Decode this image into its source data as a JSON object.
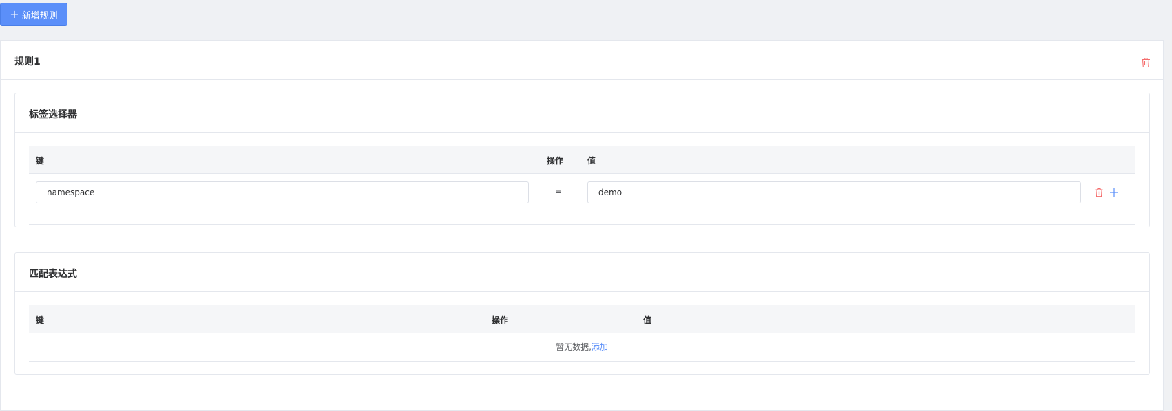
{
  "toolbar": {
    "add_rule_icon": "+",
    "add_rule_label": "新增规则"
  },
  "rule": {
    "title": "规则1",
    "delete_icon": "trash-icon",
    "label_selector": {
      "title": "标签选择器",
      "columns": {
        "key": "键",
        "operator": "操作",
        "value": "值"
      },
      "rows": [
        {
          "key": "namespace",
          "operator": "=",
          "value": "demo"
        }
      ]
    },
    "match_expressions": {
      "title": "匹配表达式",
      "columns": {
        "key": "键",
        "operator": "操作",
        "value": "值"
      },
      "empty_text": "暂无数据,",
      "add_link": "添加"
    }
  },
  "colors": {
    "primary": "#5b8ff9",
    "danger": "#f56c6c",
    "page_background": "#eff1f4"
  }
}
